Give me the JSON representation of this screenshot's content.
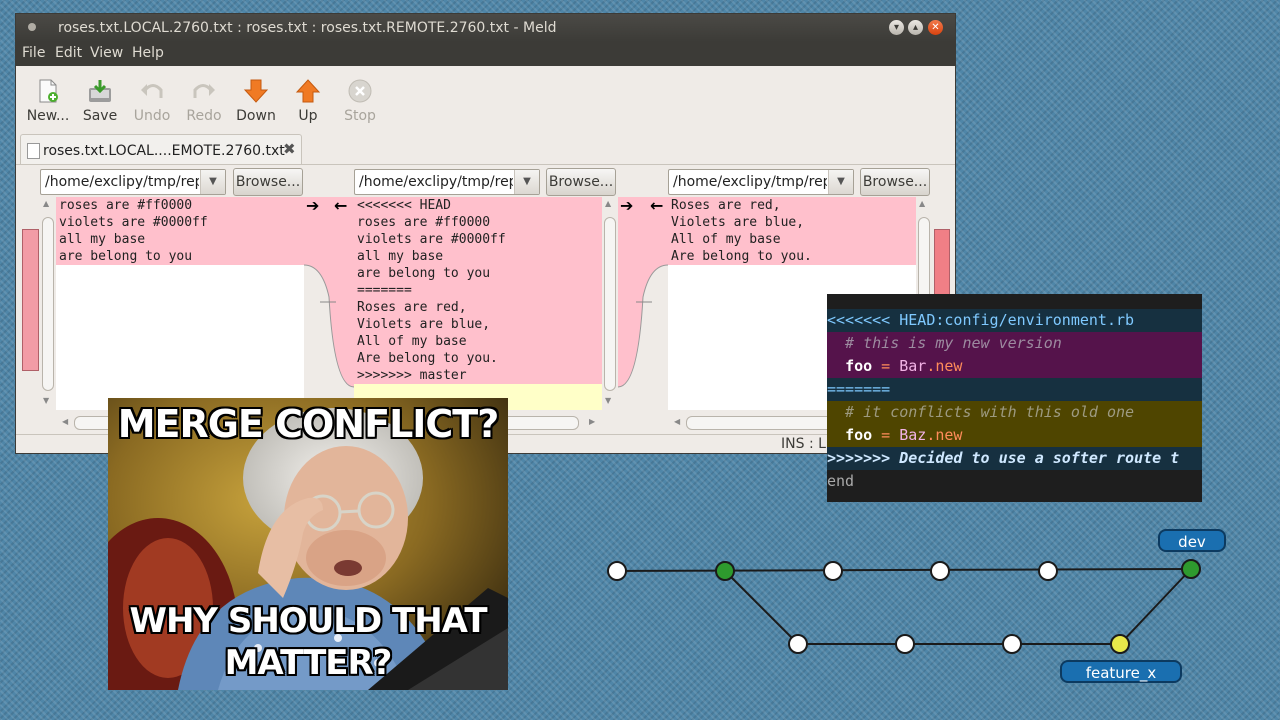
{
  "meld": {
    "title": "roses.txt.LOCAL.2760.txt : roses.txt : roses.txt.REMOTE.2760.txt - Meld",
    "menu": [
      "File",
      "Edit",
      "View",
      "Help"
    ],
    "toolbar": {
      "new": "New...",
      "save": "Save",
      "undo": "Undo",
      "redo": "Redo",
      "down": "Down",
      "up": "Up",
      "stop": "Stop"
    },
    "tab_label": "roses.txt.LOCAL....EMOTE.2760.txt",
    "path_value": "/home/exclipy/tmp/repo",
    "browse_label": "Browse...",
    "left_lines": [
      "roses are #ff0000",
      "violets are #0000ff",
      "all my base",
      "are belong to you"
    ],
    "middle_lines": [
      "<<<<<<< HEAD",
      "roses are #ff0000",
      "violets are #0000ff",
      "all my base",
      "are belong to you",
      "=======",
      "Roses are red,",
      "Violets are blue,",
      "All of my base",
      "Are belong to you.",
      ">>>>>>> master"
    ],
    "right_lines": [
      "Roses are red,",
      "Violets are blue,",
      "All of my base",
      "Are belong to you."
    ],
    "status": "INS : Ln"
  },
  "meme": {
    "top_text": "MERGE CONFLICT?",
    "bottom_line1": "WHY SHOULD THAT",
    "bottom_line2": "MATTER?"
  },
  "code_panel": {
    "line1": "<<<<<<< HEAD:config/environment.rb",
    "line2": "  # this is my new version",
    "line3_var": "foo",
    "line3_op": " = ",
    "line3_class": "Bar",
    "line3_method": ".new",
    "line4": "=======",
    "line5": "  # it conflicts with this old one",
    "line6_var": "foo",
    "line6_op": " = ",
    "line6_class": "Baz",
    "line6_method": ".new",
    "line7": ">>>>>>> Decided to use a softer route t",
    "line8": "end"
  },
  "git_graph": {
    "branch_dev": "dev",
    "branch_feature": "feature_x",
    "colors": {
      "commit": "#ffffff",
      "merge_base": "#2e9a2e",
      "feature_tip": "#e8e84a",
      "label_bg": "#1a6fb0"
    }
  },
  "colors": {
    "conflict_highlight": "#ffc0cc",
    "current_change": "#ffffc8"
  }
}
